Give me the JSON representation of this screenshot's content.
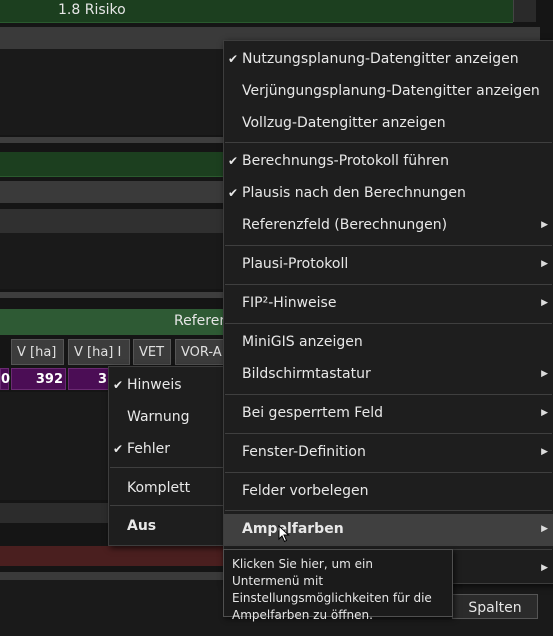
{
  "background": {
    "top_green_label": "1.8 Risiko",
    "section_label": "Referer",
    "grid_headers": [
      "V [ha]",
      "V [ha] I",
      "VET",
      "VOR-A"
    ],
    "grid_values": [
      "0",
      "392",
      "3"
    ],
    "spalten_button": "Spalten"
  },
  "main_menu": {
    "items": [
      {
        "label": "Nutzungsplanung-Datengitter anzeigen",
        "checked": true,
        "submenu": false
      },
      {
        "label": "Verjüngungsplanung-Datengitter anzeigen",
        "checked": false,
        "submenu": false
      },
      {
        "label": "Vollzug-Datengitter anzeigen",
        "checked": false,
        "submenu": false
      },
      {
        "label": "Berechnungs-Protokoll führen",
        "checked": true,
        "submenu": false
      },
      {
        "label": "Plausis nach den Berechnungen",
        "checked": true,
        "submenu": false
      },
      {
        "label": "Referenzfeld (Berechnungen)",
        "checked": false,
        "submenu": true
      },
      {
        "label": "Plausi-Protokoll",
        "checked": false,
        "submenu": true
      },
      {
        "label": "FIP²-Hinweise",
        "checked": false,
        "submenu": true
      },
      {
        "label": "MiniGIS anzeigen",
        "checked": false,
        "submenu": false
      },
      {
        "label": "Bildschirmtastatur",
        "checked": false,
        "submenu": true
      },
      {
        "label": "Bei gesperrtem Feld",
        "checked": false,
        "submenu": true
      },
      {
        "label": "Fenster-Definition",
        "checked": false,
        "submenu": true
      },
      {
        "label": "Felder vorbelegen",
        "checked": false,
        "submenu": false
      },
      {
        "label": "Ampelfarben",
        "checked": false,
        "submenu": true,
        "highlighted": true
      }
    ],
    "check_glyph": "✔",
    "arrow_glyph": "▶"
  },
  "sub_menu": {
    "items": [
      {
        "label": "Hinweis",
        "checked": true
      },
      {
        "label": "Warnung",
        "checked": false
      },
      {
        "label": "Fehler",
        "checked": true
      },
      {
        "label": "Komplett",
        "checked": false
      },
      {
        "label": "Aus",
        "checked": false,
        "bold": true
      }
    ]
  },
  "tooltip": {
    "text": "Klicken Sie hier, um ein Untermenü mit Einstellungsmöglichkeiten für die Ampelfarben zu öffnen."
  },
  "colors": {
    "green_bar": "#1c3f1f",
    "purple_cell": "#4b0d55",
    "menu_bg": "#1e1e1e"
  }
}
